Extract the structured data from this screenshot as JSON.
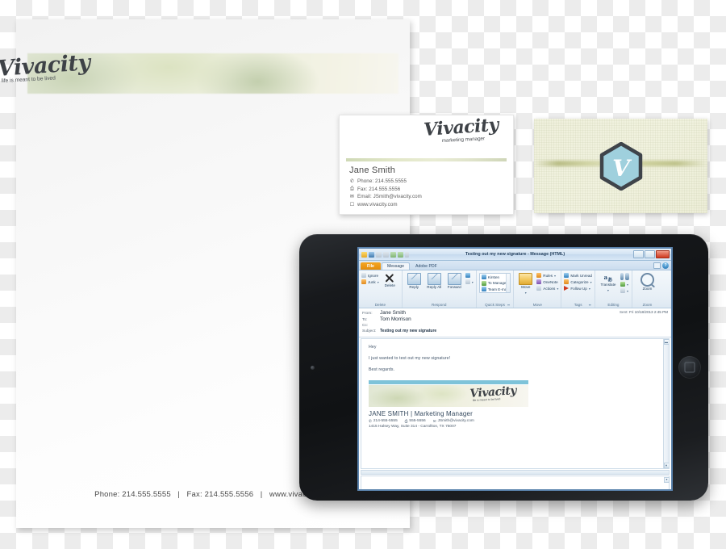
{
  "brand": {
    "name": "Vivacity",
    "tagline": "life is meant to be lived",
    "accent_green": "#dfe5d2",
    "accent_blue": "#7ec3d9",
    "hex_letter": "V"
  },
  "letterhead": {
    "footer_phone": "Phone: 214.555.5555",
    "sep1": "   |   ",
    "footer_fax": "Fax: 214.555.5556",
    "sep2": "   |   ",
    "footer_web": "www.vivacity.com"
  },
  "business_card_front": {
    "logo_word": "Vivacity",
    "logo_tagline": "marketing manager",
    "name": "Jane Smith",
    "contacts": [
      {
        "icon": "phone-icon",
        "glyph": "✆",
        "text": "Phone: 214.555.5555"
      },
      {
        "icon": "fax-icon",
        "glyph": "⎙",
        "text": "Fax: 214.555.5556"
      },
      {
        "icon": "email-icon",
        "glyph": "✉",
        "text": "Email: JSmith@vivacity.com"
      },
      {
        "icon": "web-icon",
        "glyph": "☐",
        "text": "www.vivacity.com"
      }
    ]
  },
  "business_card_back": {
    "badge_letter": "V"
  },
  "outlook": {
    "title": "Testing out my new signature - Message (HTML)",
    "quick_access": [
      "mail-icon",
      "save-icon",
      "undo-icon",
      "redo-icon",
      "previous-icon",
      "next-icon",
      "customize-icon"
    ],
    "window_buttons": [
      "minimize",
      "restore",
      "close"
    ],
    "tabs": [
      {
        "label": "File",
        "active": false,
        "style": "file"
      },
      {
        "label": "Message",
        "active": true,
        "style": "normal"
      },
      {
        "label": "Adobe PDF",
        "active": false,
        "style": "normal"
      }
    ],
    "help_glyph": "?",
    "ribbon": [
      {
        "title": "Delete",
        "small": [
          {
            "label": "Ignore",
            "icon": "ignore-icon",
            "color": "grey"
          },
          {
            "label": "Junk",
            "icon": "junk-icon",
            "color": "orange",
            "caret": "▾"
          }
        ],
        "big": [
          {
            "label": "Delete",
            "icon": "delete-x-icon"
          }
        ]
      },
      {
        "title": "Respond",
        "big": [
          {
            "label": "Reply",
            "icon": "reply-icon"
          },
          {
            "label": "Reply All",
            "icon": "reply-all-icon"
          },
          {
            "label": "Forward",
            "icon": "forward-icon"
          }
        ],
        "small": [
          {
            "label": "",
            "icon": "im-icon",
            "color": "blue"
          },
          {
            "label": "",
            "icon": "more-icon",
            "color": "grey",
            "caret": "▾"
          }
        ]
      },
      {
        "title": "Quick Steps",
        "dialog_launcher": "⬌",
        "list": [
          {
            "label": "Kirsten",
            "icon": "quickstep-person-icon",
            "color": "blue"
          },
          {
            "label": "To Manager",
            "icon": "quickstep-manager-icon",
            "color": "green"
          },
          {
            "label": "Team E-mail",
            "icon": "quickstep-team-icon",
            "color": "blue"
          }
        ]
      },
      {
        "title": "Move",
        "big": [
          {
            "label": "Move",
            "icon": "move-folder-icon",
            "caret": "▾"
          }
        ],
        "small": [
          {
            "label": "Rules",
            "icon": "rules-icon",
            "color": "orange",
            "caret": "▾"
          },
          {
            "label": "OneNote",
            "icon": "onenote-icon",
            "color": "purple"
          },
          {
            "label": "Actions",
            "icon": "actions-icon",
            "color": "grey",
            "caret": "▾"
          }
        ]
      },
      {
        "title": "Tags",
        "dialog_launcher": "⬌",
        "small": [
          {
            "label": "Mark Unread",
            "icon": "mark-unread-icon",
            "color": "blue"
          },
          {
            "label": "Categorize",
            "icon": "categorize-icon",
            "color": "orange",
            "caret": "▾"
          },
          {
            "label": "Follow Up",
            "icon": "follow-up-flag-icon",
            "color": "red",
            "caret": "▾"
          }
        ]
      },
      {
        "title": "Editing",
        "big": [
          {
            "label": "Translate",
            "icon": "translate-icon",
            "caret": "▾"
          }
        ],
        "small": [
          {
            "label": "",
            "icon": "find-binoculars-icon",
            "color": "blue"
          },
          {
            "label": "",
            "icon": "related-icon",
            "color": "green",
            "caret": "▾"
          },
          {
            "label": "",
            "icon": "select-icon",
            "color": "grey",
            "caret": "▾"
          }
        ]
      },
      {
        "title": "Zoom",
        "big": [
          {
            "label": "Zoom",
            "icon": "zoom-magnifier-icon"
          }
        ]
      }
    ],
    "header": {
      "from_label": "From:",
      "from_value": "Jane Smith",
      "to_label": "To:",
      "to_value": "Tom Morrison",
      "cc_label": "Cc:",
      "cc_value": "",
      "subject_label": "Subject:",
      "subject_value": "Testing out my new signature",
      "sent_label": "Sent:",
      "sent_value": "Fri 10/18/2013 2:45 PM"
    },
    "body": {
      "greeting": "Hey",
      "paragraph": "I just wanted to test out my new signature!",
      "closing": "Best regards."
    },
    "signature": {
      "logo_word": "Vivacity",
      "logo_tagline": "life is meant to be lived",
      "name_line": "JANE SMITH  |  Marketing Manager",
      "contacts": [
        {
          "icon": "phone-icon",
          "glyph": "✆",
          "text": "214-555-5555"
        },
        {
          "icon": "fax-icon",
          "glyph": "⎙",
          "text": "555-5556"
        },
        {
          "icon": "email-icon",
          "glyph": "✉",
          "text": "JSmith@vivacity.com"
        }
      ],
      "address": "1415 Halsey Way, Suite 314 - Carrollton, TX 75007"
    },
    "scroll_glyphs": {
      "up": "▲",
      "down": "▼",
      "split": "▬"
    }
  }
}
